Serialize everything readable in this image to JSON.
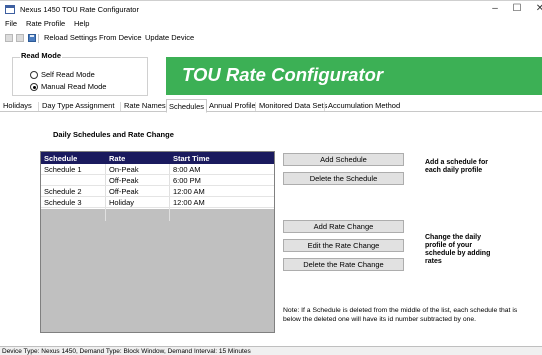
{
  "window": {
    "title": "Nexus 1450 TOU Rate Configurator",
    "controls": {
      "minimize": "–",
      "maximize": "☐",
      "close": "✕"
    }
  },
  "menu": [
    "File",
    "Rate Profile",
    "Help"
  ],
  "toolbar": {
    "reload_label": "Reload Settings From Device",
    "update_label": "Update Device"
  },
  "read_mode": {
    "legend": "Read Mode",
    "options": [
      {
        "label": "Self Read Mode",
        "selected": false
      },
      {
        "label": "Manual Read Mode",
        "selected": true
      }
    ]
  },
  "banner": {
    "title": "TOU Rate Configurator",
    "color": "#3cb055"
  },
  "tabs": [
    {
      "label": "Holidays",
      "active": false
    },
    {
      "label": "Day Type Assignment",
      "active": false
    },
    {
      "label": "Rate Names",
      "active": false
    },
    {
      "label": "Schedules",
      "active": true
    },
    {
      "label": "Annual Profile",
      "active": false
    },
    {
      "label": "Monitored Data Sets",
      "active": false
    },
    {
      "label": "Accumulation Method",
      "active": false
    }
  ],
  "schedules": {
    "section_title": "Daily Schedules and Rate Change",
    "columns": [
      "Schedule",
      "Rate",
      "Start Time"
    ],
    "rows": [
      {
        "schedule": "Schedule 1",
        "rate": "On-Peak",
        "start": "8:00 AM"
      },
      {
        "schedule": "",
        "rate": "Off-Peak",
        "start": "6:00 PM"
      },
      {
        "schedule": "Schedule 2",
        "rate": "Off-Peak",
        "start": "12:00 AM"
      },
      {
        "schedule": "Schedule 3",
        "rate": "Holiday",
        "start": "12:00 AM"
      }
    ],
    "header_color": "#1a1a5e"
  },
  "buttons": {
    "add_schedule": "Add Schedule",
    "delete_schedule": "Delete the Schedule",
    "add_rate_change": "Add Rate Change",
    "edit_rate_change": "Edit the Rate Change",
    "delete_rate_change": "Delete the Rate Change"
  },
  "help": {
    "schedule_hint": "Add a schedule for\neach daily profile",
    "rate_hint": "Change the daily\nprofile of your\nschedule by adding\nrates",
    "note": "Note: If a Schedule is deleted from the middle of the list, each schedule that is below the deleted one will have its id number subtracted by one."
  },
  "status": "Device Type: Nexus 1450, Demand Type: Block Window, Demand Interval: 15 Minutes"
}
